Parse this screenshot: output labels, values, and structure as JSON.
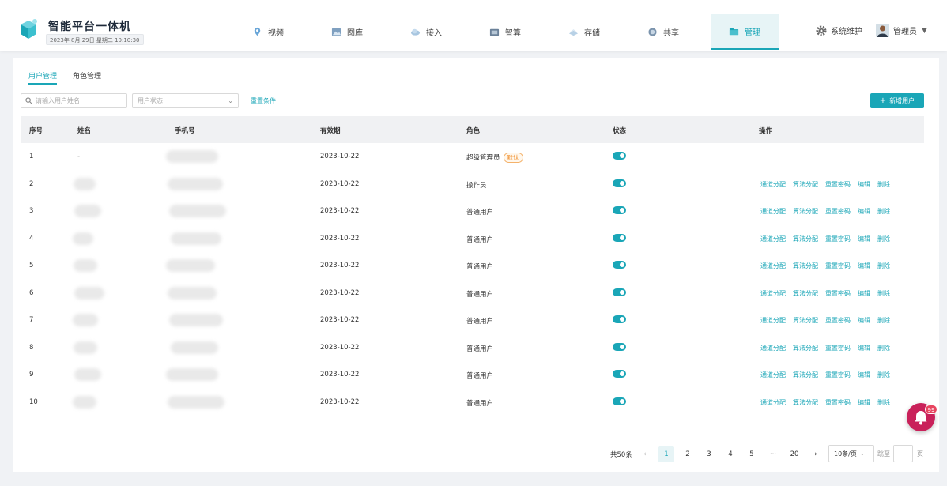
{
  "app": {
    "title": "智能平台一体机",
    "datetime": "2023年 8月 29日  星期二  10:10:30"
  },
  "nav": {
    "items": [
      {
        "label": "视频",
        "icon": "location-pin-icon"
      },
      {
        "label": "图库",
        "icon": "gallery-icon"
      },
      {
        "label": "接入",
        "icon": "cloud-link-icon"
      },
      {
        "label": "智算",
        "icon": "compute-icon"
      },
      {
        "label": "存储",
        "icon": "storage-icon"
      },
      {
        "label": "共享",
        "icon": "share-icon"
      },
      {
        "label": "管理",
        "icon": "folder-icon",
        "active": true
      }
    ],
    "system_label": "系统维护",
    "user_label": "管理员"
  },
  "tabs": [
    {
      "label": "用户管理",
      "active": true
    },
    {
      "label": "角色管理"
    }
  ],
  "filters": {
    "search_placeholder": "请输入用户姓名",
    "status_placeholder": "用户状态",
    "reset_label": "重置条件",
    "add_label": "新增用户"
  },
  "table": {
    "columns": [
      "序号",
      "姓名",
      "手机号",
      "有效期",
      "角色",
      "状态",
      "操作"
    ],
    "default_tag": "默认",
    "actions": [
      "通道分配",
      "算法分配",
      "重置密码",
      "编辑",
      "删除"
    ],
    "rows": [
      {
        "no": "1",
        "name": "-",
        "expiry": "2023-10-22",
        "role": "超级管理员",
        "is_default": true,
        "enabled": true
      },
      {
        "no": "2",
        "name": "",
        "expiry": "2023-10-22",
        "role": "操作员",
        "enabled": true
      },
      {
        "no": "3",
        "name": "",
        "expiry": "2023-10-22",
        "role": "普通用户",
        "enabled": true
      },
      {
        "no": "4",
        "name": "",
        "expiry": "2023-10-22",
        "role": "普通用户",
        "enabled": true
      },
      {
        "no": "5",
        "name": "",
        "expiry": "2023-10-22",
        "role": "普通用户",
        "enabled": true
      },
      {
        "no": "6",
        "name": "",
        "expiry": "2023-10-22",
        "role": "普通用户",
        "enabled": true
      },
      {
        "no": "7",
        "name": "",
        "expiry": "2023-10-22",
        "role": "普通用户",
        "enabled": true
      },
      {
        "no": "8",
        "name": "",
        "expiry": "2023-10-22",
        "role": "普通用户",
        "enabled": true
      },
      {
        "no": "9",
        "name": "",
        "expiry": "2023-10-22",
        "role": "普通用户",
        "enabled": true
      },
      {
        "no": "10",
        "name": "",
        "expiry": "2023-10-22",
        "role": "普通用户",
        "enabled": true
      }
    ]
  },
  "pagination": {
    "total": "共50条",
    "prev": "‹",
    "pages": [
      "1",
      "2",
      "3",
      "4",
      "5",
      "···",
      "20"
    ],
    "current": "1",
    "next": "›",
    "page_size": "10条/页",
    "goto_label": "跳至",
    "page_suffix": "页"
  },
  "notification": {
    "count": "99"
  },
  "colors": {
    "accent": "#1aa6b7",
    "tag": "#f08a24",
    "bell": "#c9215a"
  }
}
